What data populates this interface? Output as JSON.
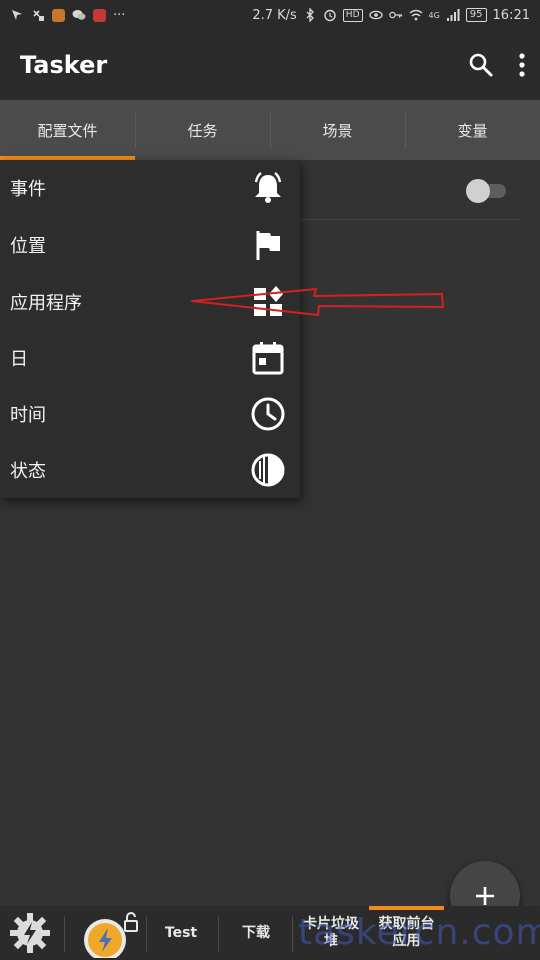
{
  "status_bar": {
    "speed": "2.7 K/s",
    "hd": "HD",
    "network": "4G",
    "battery": "95",
    "time": "16:21",
    "dots": "···"
  },
  "app": {
    "title": "Tasker"
  },
  "tabs": [
    {
      "label": "配置文件",
      "active": true
    },
    {
      "label": "任务",
      "active": false
    },
    {
      "label": "场景",
      "active": false
    },
    {
      "label": "变量",
      "active": false
    }
  ],
  "menu": {
    "items": [
      {
        "label": "事件",
        "icon": "bell-icon"
      },
      {
        "label": "位置",
        "icon": "flag-icon"
      },
      {
        "label": "应用程序",
        "icon": "apps-icon"
      },
      {
        "label": "日",
        "icon": "calendar-icon"
      },
      {
        "label": "时间",
        "icon": "clock-icon"
      },
      {
        "label": "状态",
        "icon": "state-icon"
      }
    ]
  },
  "bottom_bar": {
    "items": [
      {
        "label": "",
        "icon": "gear-icon"
      },
      {
        "label": "",
        "icon": "tasker-lock-icon"
      },
      {
        "label": "Test"
      },
      {
        "label": "下载"
      },
      {
        "label": "卡片垃圾\n堆"
      },
      {
        "label": "获取前台\n应用",
        "active": true
      }
    ]
  },
  "watermark": "taskercn.com",
  "colors": {
    "accent": "#f08a1e",
    "background": "#333333",
    "annotation": "#d42020"
  }
}
